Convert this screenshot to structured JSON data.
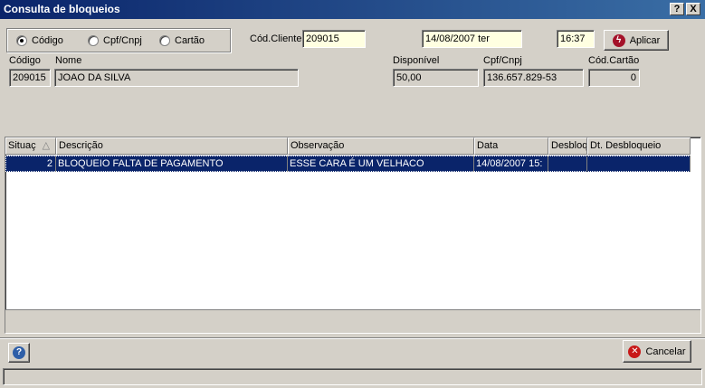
{
  "window": {
    "title": "Consulta de bloqueios",
    "help_btn": "?",
    "close_btn": "X"
  },
  "search_mode": {
    "options": [
      "Código",
      "Cpf/Cnpj",
      "Cartão"
    ],
    "selected": "Código"
  },
  "client_filter": {
    "label": "Cód.Cliente",
    "value": "209015"
  },
  "date_field": "14/08/2007 ter",
  "time_field": "16:37",
  "apply_button": "Aplicar",
  "client": {
    "codigo_label": "Código",
    "codigo": "209015",
    "nome_label": "Nome",
    "nome": "JOAO DA SILVA",
    "disponivel_label": "Disponível",
    "disponivel": "50,00",
    "cpf_label": "Cpf/Cnpj",
    "cpf": "136.657.829-53",
    "cartao_label": "Cód.Cartão",
    "cartao": "0"
  },
  "grid": {
    "columns": [
      "Situaç",
      "Descrição",
      "Observação",
      "Data",
      "Desbloq",
      "Dt. Desbloqueio"
    ],
    "sort_indicator": "△",
    "rows": [
      {
        "situacao": "2",
        "descricao": "BLOQUEIO FALTA DE PAGAMENTO",
        "observacao": "ESSE CARA É UM VELHACO",
        "data": "14/08/2007 15:",
        "desbloq": "",
        "dt_desbloqueio": ""
      }
    ]
  },
  "cancel_button": "Cancelar",
  "colors": {
    "titlebar": "#0a246a",
    "selection": "#0a246a",
    "input_yellow": "#ffffe1",
    "face": "#d4d0c8"
  }
}
